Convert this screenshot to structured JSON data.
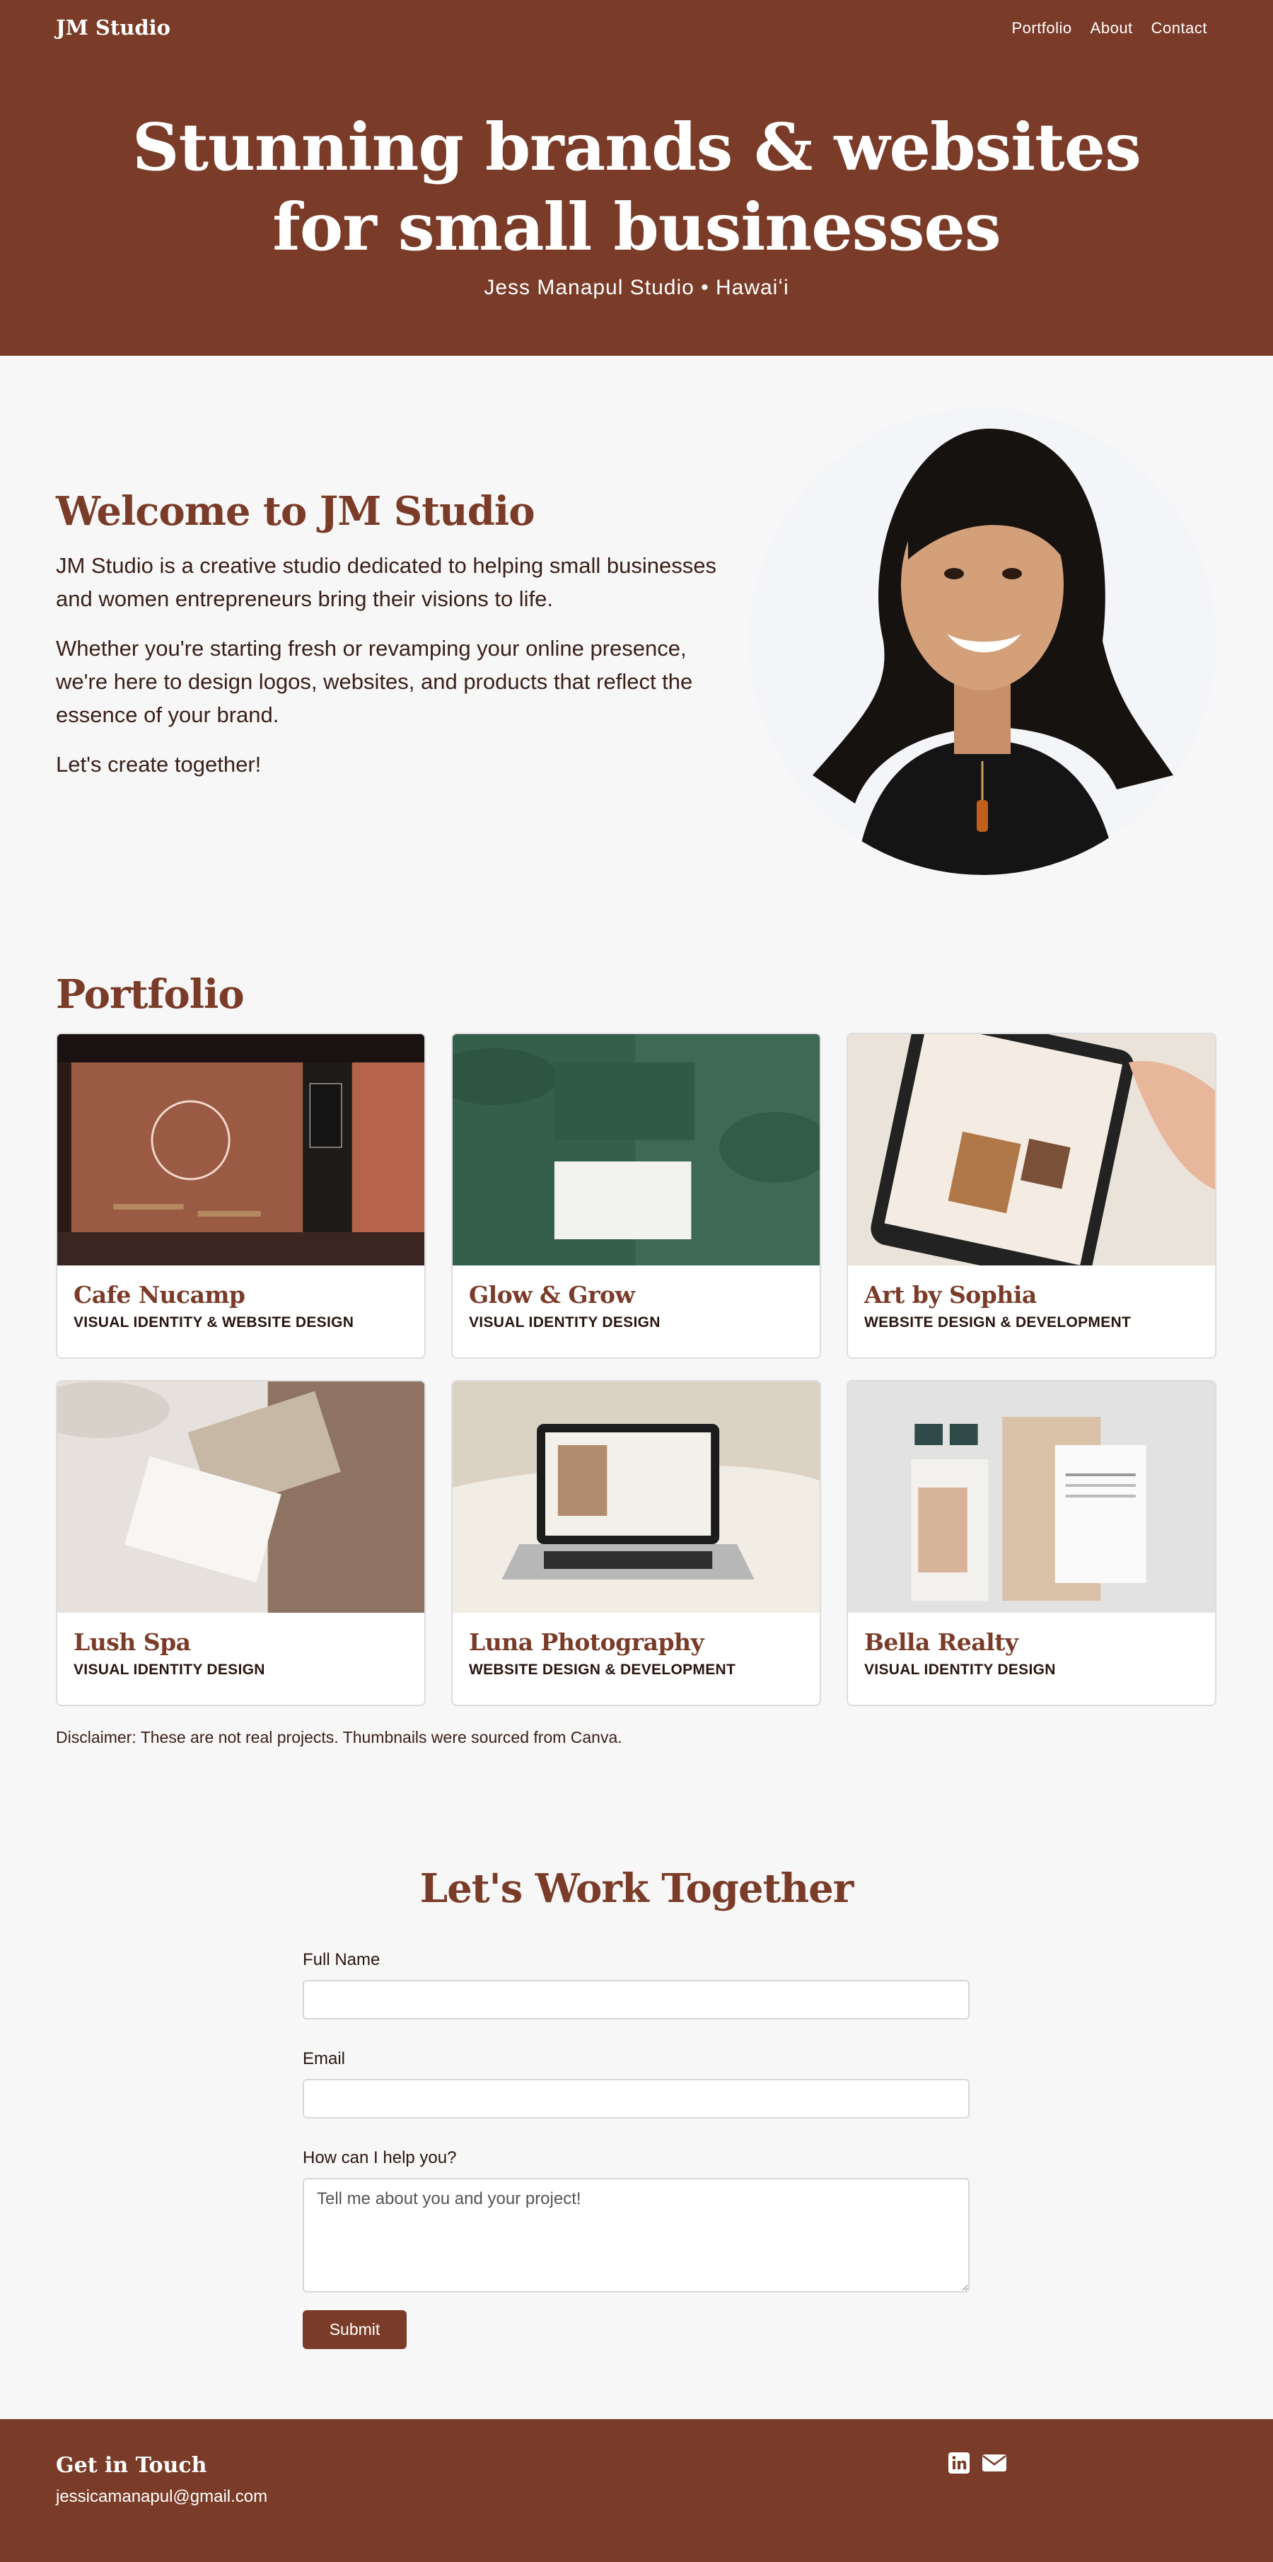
{
  "header": {
    "brand": "JM Studio",
    "nav": [
      "Portfolio",
      "About",
      "Contact"
    ]
  },
  "hero": {
    "title_line1": "Stunning brands & websites",
    "title_line2": "for small businesses",
    "subtitle": "Jess Manapul Studio • Hawaiʻi"
  },
  "welcome": {
    "title": "Welcome to JM Studio",
    "p1": "JM Studio is a creative studio dedicated to helping small businesses and women entrepreneurs bring their visions to life.",
    "p2": "Whether you're starting fresh or revamping your online presence, we're here to design logos, websites, and products that reflect the essence of your brand.",
    "p3": "Let's create together!"
  },
  "portfolio": {
    "title": "Portfolio",
    "items": [
      {
        "name": "Cafe Nucamp",
        "tag": "VISUAL IDENTITY & WEBSITE DESIGN"
      },
      {
        "name": "Glow & Grow",
        "tag": "VISUAL IDENTITY DESIGN"
      },
      {
        "name": "Art by Sophia",
        "tag": "WEBSITE DESIGN & DEVELOPMENT"
      },
      {
        "name": "Lush Spa",
        "tag": "VISUAL IDENTITY DESIGN"
      },
      {
        "name": "Luna Photography",
        "tag": "WEBSITE DESIGN & DEVELOPMENT"
      },
      {
        "name": "Bella Realty",
        "tag": "VISUAL IDENTITY DESIGN"
      }
    ],
    "disclaimer": "Disclaimer: These are not real projects. Thumbnails were sourced from Canva."
  },
  "contact": {
    "title": "Let's Work Together",
    "name_label": "Full Name",
    "email_label": "Email",
    "message_label": "How can I help you?",
    "message_placeholder": "Tell me about you and your project!",
    "submit_label": "Submit"
  },
  "footer": {
    "title": "Get in Touch",
    "email": "jessicamanapul@gmail.com",
    "icons": [
      "linkedin-icon",
      "envelope-icon"
    ]
  },
  "colors": {
    "brand": "#7a3c28",
    "background": "#f7f7f7"
  }
}
